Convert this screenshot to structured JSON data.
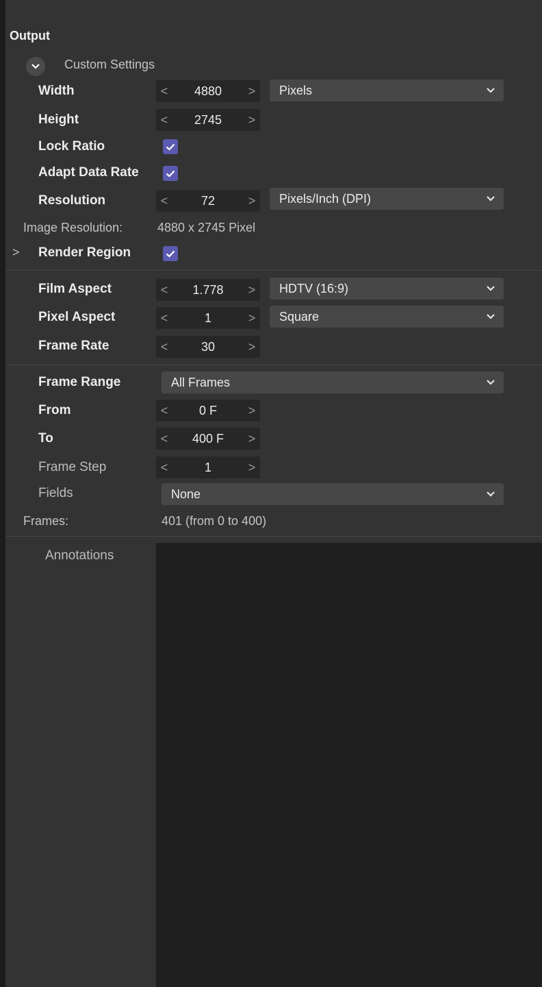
{
  "output": {
    "title": "Output",
    "preset": "Custom Settings",
    "width": {
      "label": "Width",
      "value": "4880",
      "unit": "Pixels"
    },
    "height": {
      "label": "Height",
      "value": "2745"
    },
    "lock_ratio": {
      "label": "Lock Ratio",
      "checked": true
    },
    "adapt_data_rate": {
      "label": "Adapt Data Rate",
      "checked": true
    },
    "resolution": {
      "label": "Resolution",
      "value": "72",
      "unit": "Pixels/Inch (DPI)"
    },
    "image_resolution": {
      "label": "Image Resolution:",
      "value": "4880 x 2745 Pixel"
    },
    "render_region": {
      "label": "Render Region",
      "checked": true
    },
    "film_aspect": {
      "label": "Film Aspect",
      "value": "1.778",
      "preset": "HDTV (16:9)"
    },
    "pixel_aspect": {
      "label": "Pixel Aspect",
      "value": "1",
      "preset": "Square"
    },
    "frame_rate": {
      "label": "Frame Rate",
      "value": "30"
    },
    "frame_range": {
      "label": "Frame Range",
      "value": "All Frames"
    },
    "from": {
      "label": "From",
      "value": "0 F"
    },
    "to": {
      "label": "To",
      "value": "400 F"
    },
    "frame_step": {
      "label": "Frame Step",
      "value": "1"
    },
    "fields": {
      "label": "Fields",
      "value": "None"
    },
    "frames": {
      "label": "Frames:",
      "value": "401 (from 0 to 400)"
    },
    "annotations": {
      "label": "Annotations",
      "value": ""
    }
  },
  "icons": {
    "expand": "chevron-down-icon",
    "collapsed": "chevron-right-icon",
    "decrement": "chevron-left-icon",
    "increment": "chevron-right-icon",
    "dropdown": "chevron-down-icon",
    "check": "checkmark-icon"
  },
  "colors": {
    "background": "#333333",
    "field": "#272727",
    "dropdown": "#474747",
    "checkbox": "#5a5ab0",
    "annotations": "#1f1f1f"
  }
}
